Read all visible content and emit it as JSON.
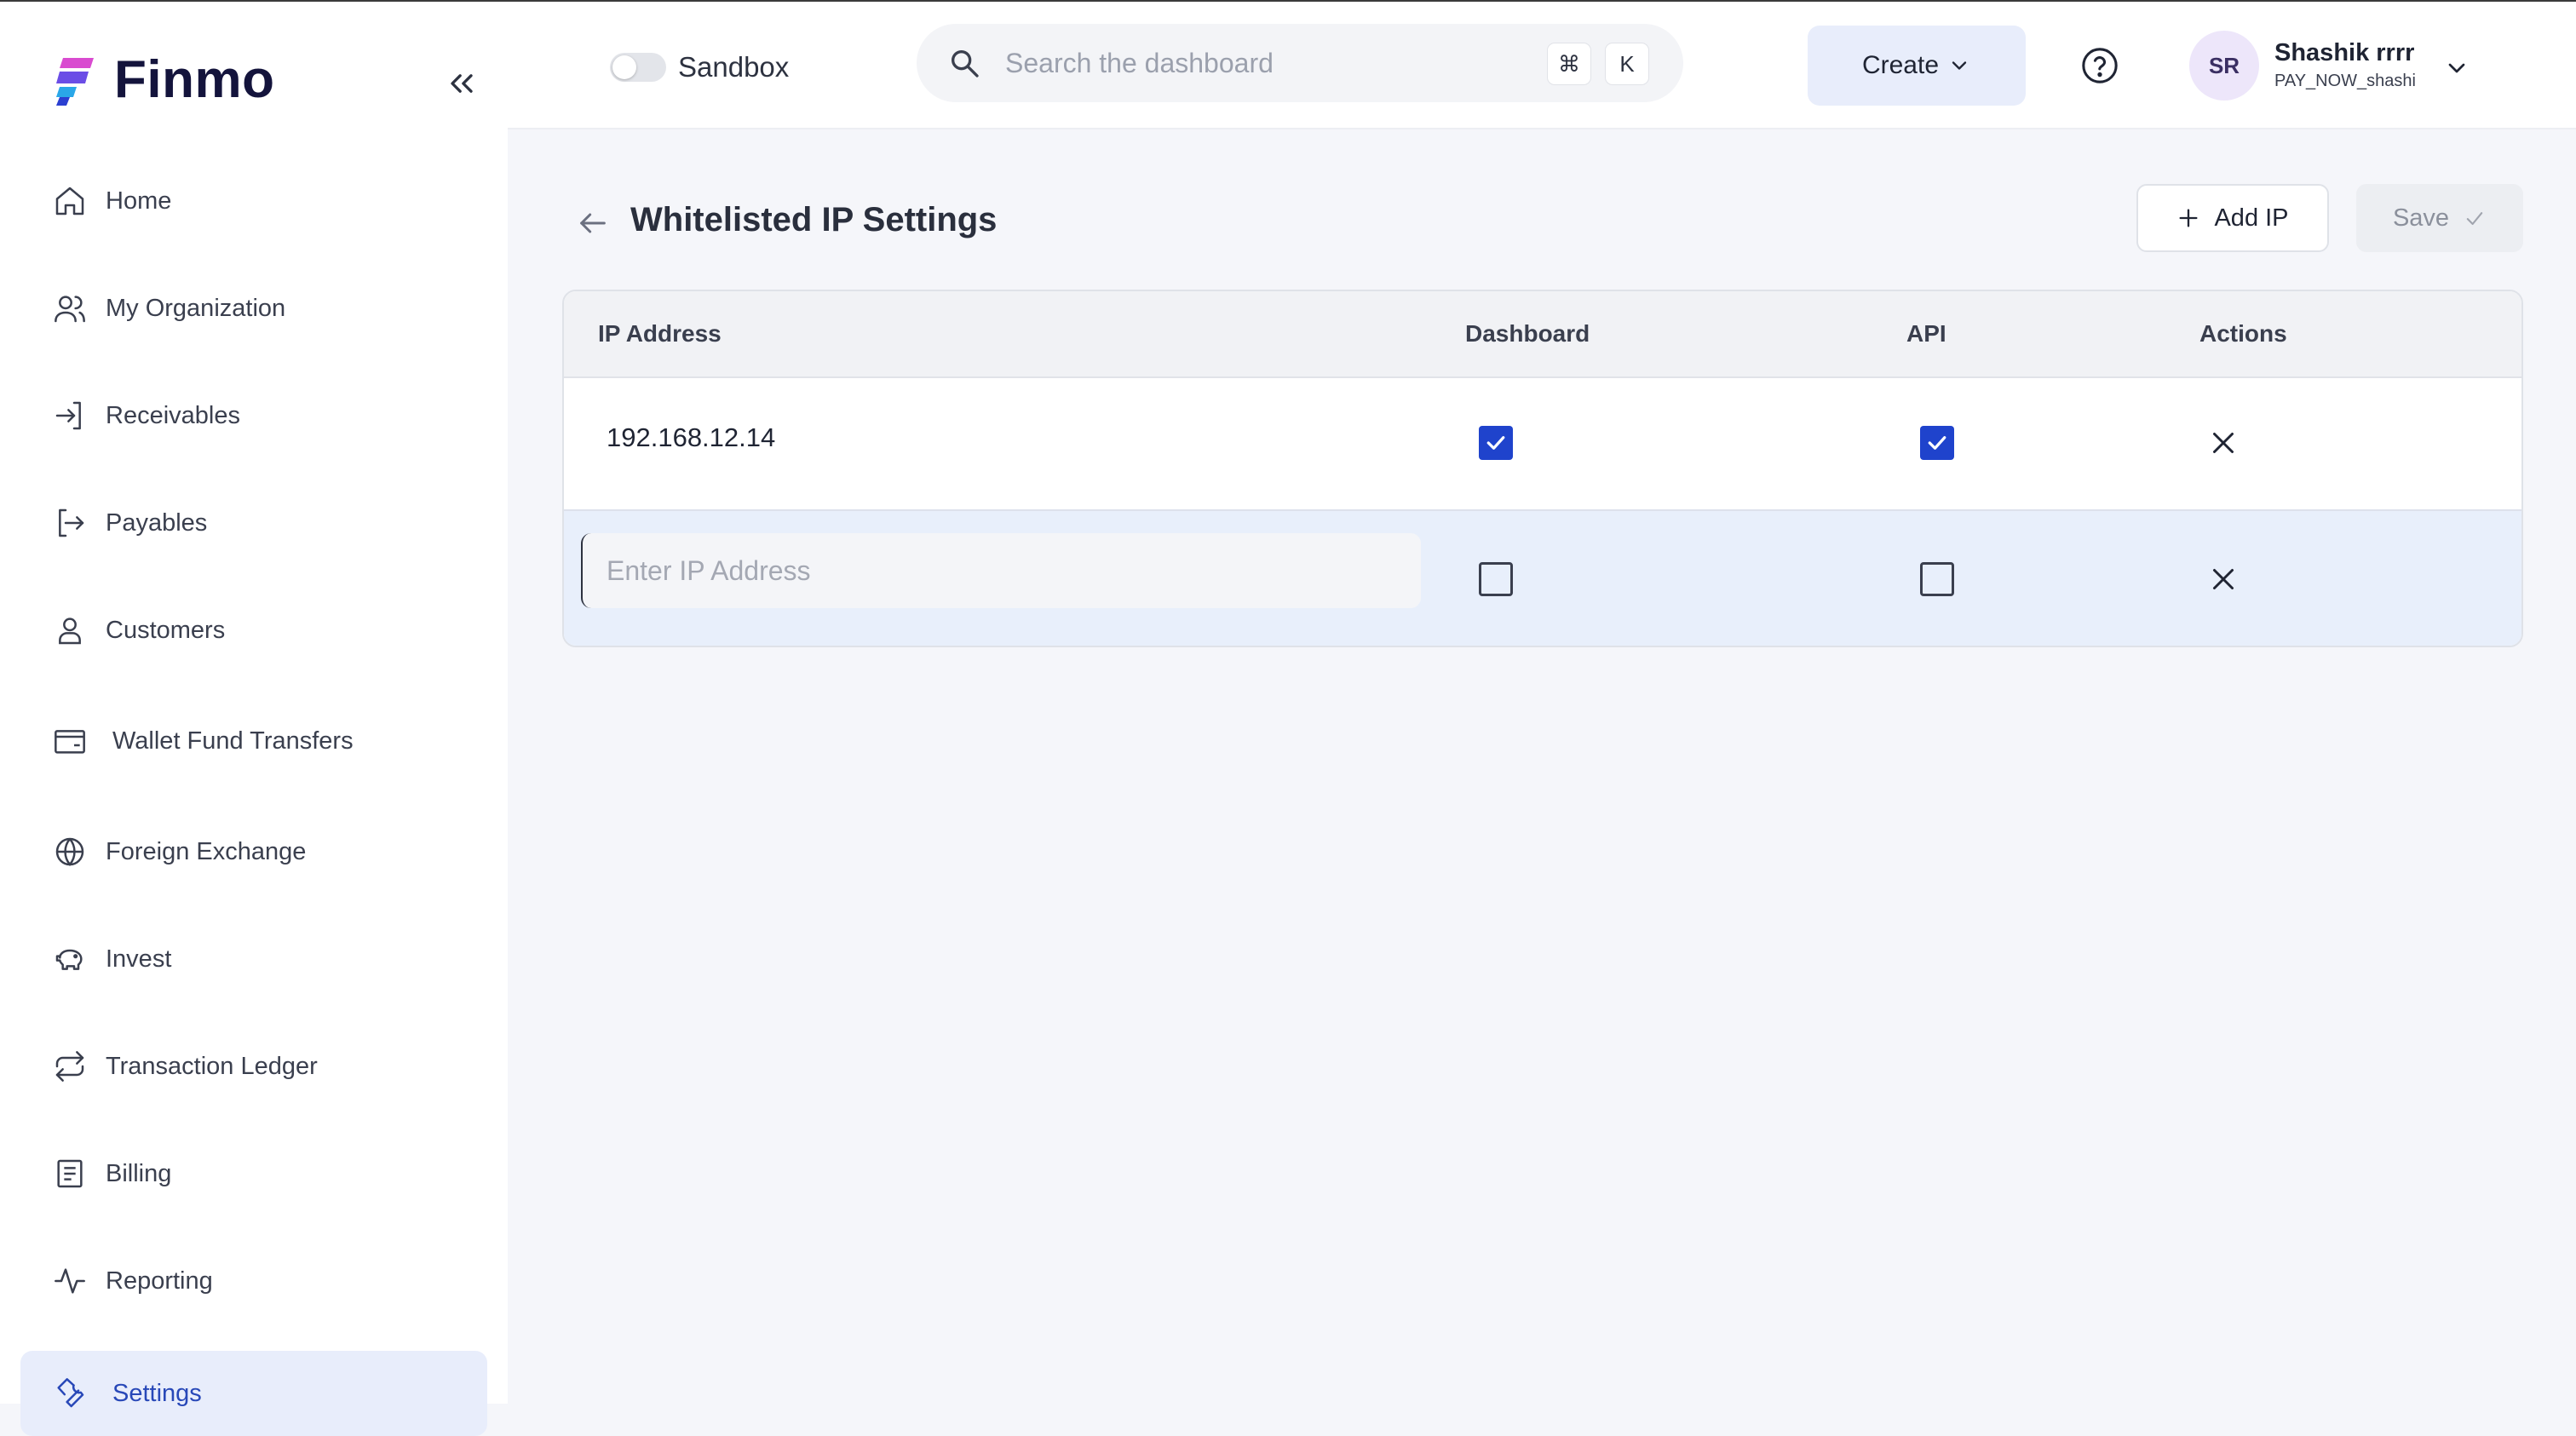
{
  "app": {
    "name": "Finmo"
  },
  "sidebar": {
    "items": [
      {
        "label": "Home",
        "icon": "home-icon"
      },
      {
        "label": "My Organization",
        "icon": "users-icon"
      },
      {
        "label": "Receivables",
        "icon": "sign-in-icon"
      },
      {
        "label": "Payables",
        "icon": "sign-out-icon"
      },
      {
        "label": "Customers",
        "icon": "user-icon"
      },
      {
        "label": "Wallet Fund Transfers",
        "icon": "wallet-icon"
      },
      {
        "label": "Foreign Exchange",
        "icon": "globe-icon"
      },
      {
        "label": "Invest",
        "icon": "piggy-bank-icon"
      },
      {
        "label": "Transaction Ledger",
        "icon": "repeat-icon"
      },
      {
        "label": "Billing",
        "icon": "receipt-icon"
      },
      {
        "label": "Reporting",
        "icon": "activity-icon"
      },
      {
        "label": "Settings",
        "icon": "wrench-icon",
        "active": true
      }
    ]
  },
  "header": {
    "sandbox_label": "Sandbox",
    "sandbox_enabled": false,
    "search_placeholder": "Search the dashboard",
    "shortcut_keys": [
      "⌘",
      "K"
    ],
    "create_label": "Create",
    "user": {
      "initials": "SR",
      "name": "Shashik rrrr",
      "subtitle": "PAY_NOW_shashi"
    }
  },
  "page": {
    "title": "Whitelisted IP Settings",
    "add_ip_label": "Add IP",
    "save_label": "Save"
  },
  "table": {
    "columns": [
      "IP Address",
      "Dashboard",
      "API",
      "Actions"
    ],
    "rows": [
      {
        "ip": "192.168.12.14",
        "dashboard": true,
        "api": true
      },
      {
        "ip": "",
        "ip_placeholder": "Enter IP Address",
        "dashboard": false,
        "api": false
      }
    ]
  },
  "colors": {
    "accent": "#1f43cc",
    "active_nav_bg": "#e8edfb",
    "active_nav_text": "#2848b8"
  }
}
